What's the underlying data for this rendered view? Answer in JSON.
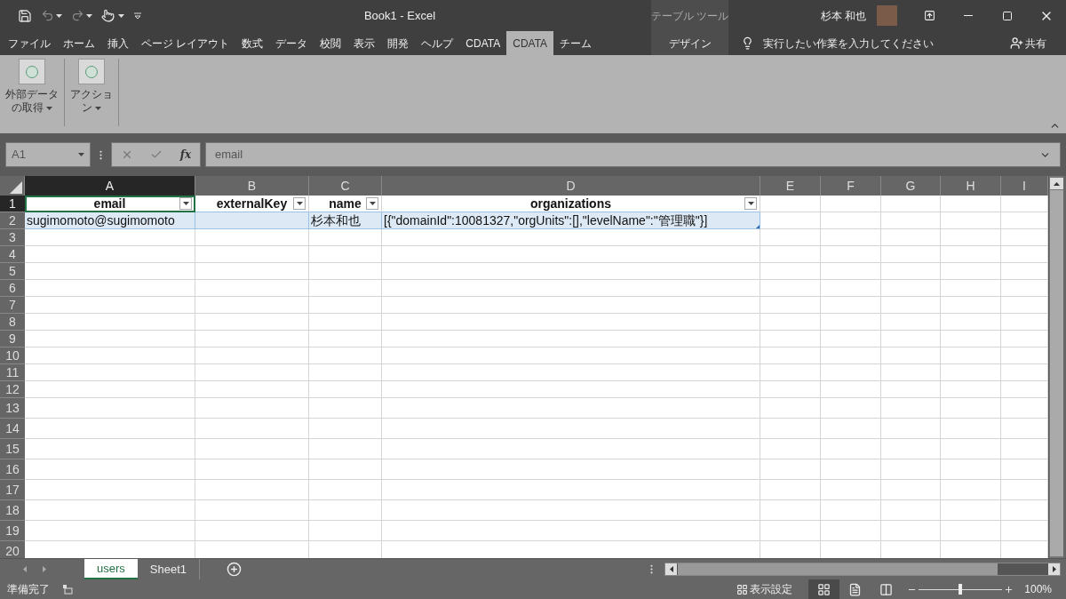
{
  "title_bar": {
    "title": "Book1 - Excel",
    "contextual_group": "テーブル ツール",
    "user": "杉本 和也"
  },
  "ribbon_tabs": [
    {
      "label": "ファイル",
      "selected": false
    },
    {
      "label": "ホーム",
      "selected": false
    },
    {
      "label": "挿入",
      "selected": false
    },
    {
      "label": "ページ レイアウト",
      "selected": false
    },
    {
      "label": "数式",
      "selected": false
    },
    {
      "label": "データ",
      "selected": false
    },
    {
      "label": "校閲",
      "selected": false
    },
    {
      "label": "表示",
      "selected": false
    },
    {
      "label": "開発",
      "selected": false
    },
    {
      "label": "ヘルプ",
      "selected": false
    },
    {
      "label": "CDATA",
      "selected": false
    },
    {
      "label": "CDATA",
      "selected": true
    },
    {
      "label": "チーム",
      "selected": false
    }
  ],
  "contextual_tab": {
    "label": "デザイン",
    "selected": false
  },
  "tell_me": "実行したい作業を入力してください",
  "share": "共有",
  "ribbon_buttons": [
    {
      "lines": [
        "外部データ",
        "の取得"
      ]
    },
    {
      "lines": [
        "アクショ",
        "ン"
      ]
    }
  ],
  "formula_bar": {
    "name_box": "A1",
    "insert_function": "fx",
    "formula": "email"
  },
  "columns": [
    {
      "label": "A",
      "selected": true
    },
    {
      "label": "B",
      "selected": false
    },
    {
      "label": "C",
      "selected": false
    },
    {
      "label": "D",
      "selected": false
    },
    {
      "label": "E",
      "selected": false
    },
    {
      "label": "F",
      "selected": false
    },
    {
      "label": "G",
      "selected": false
    },
    {
      "label": "H",
      "selected": false
    },
    {
      "label": "I",
      "selected": false
    }
  ],
  "rows": [
    {
      "label": "1",
      "selected": true
    },
    {
      "label": "2",
      "selected": false
    },
    {
      "label": "3",
      "selected": false
    },
    {
      "label": "4",
      "selected": false
    },
    {
      "label": "5",
      "selected": false
    },
    {
      "label": "6",
      "selected": false
    },
    {
      "label": "7",
      "selected": false
    },
    {
      "label": "8",
      "selected": false
    },
    {
      "label": "9",
      "selected": false
    },
    {
      "label": "10",
      "selected": false
    },
    {
      "label": "11",
      "selected": false
    },
    {
      "label": "12",
      "selected": false
    },
    {
      "label": "13",
      "selected": false
    },
    {
      "label": "14",
      "selected": false
    },
    {
      "label": "15",
      "selected": false
    },
    {
      "label": "16",
      "selected": false
    },
    {
      "label": "17",
      "selected": false
    },
    {
      "label": "18",
      "selected": false
    },
    {
      "label": "19",
      "selected": false
    },
    {
      "label": "20",
      "selected": false
    }
  ],
  "table": {
    "headers": [
      "email",
      "externalKey",
      "name",
      "organizations"
    ],
    "rows": [
      [
        "sugimomoto@sugimomoto",
        null,
        "杉本和也",
        "[{\"domainId\":10081327,\"orgUnits\":[],\"levelName\":\"管理職\"}]"
      ]
    ]
  },
  "sheet_tabs": [
    {
      "label": "users",
      "selected": true
    },
    {
      "label": "Sheet1",
      "selected": false
    }
  ],
  "status_bar": {
    "status": "準備完了",
    "display_settings": "表示設定",
    "views": [
      {
        "kind": "normal",
        "selected": true
      },
      {
        "kind": "page_layout",
        "selected": false
      },
      {
        "kind": "page_break",
        "selected": false
      }
    ],
    "zoom": {
      "level": 0.5,
      "reading": "100%"
    }
  }
}
